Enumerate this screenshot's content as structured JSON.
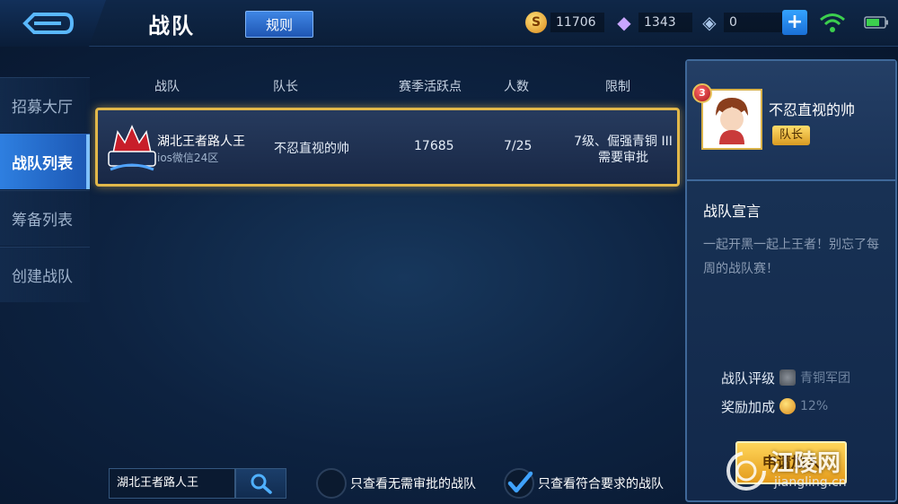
{
  "header": {
    "title": "战队",
    "rules_label": "规则",
    "currencies": [
      {
        "name": "gold-coin",
        "value": "11706"
      },
      {
        "name": "diamond",
        "value": "1343"
      },
      {
        "name": "voucher",
        "value": "0"
      }
    ]
  },
  "sidebar": {
    "items": [
      {
        "label": "招募大厅",
        "active": false
      },
      {
        "label": "战队列表",
        "active": true
      },
      {
        "label": "筹备列表",
        "active": false
      },
      {
        "label": "创建战队",
        "active": false
      }
    ]
  },
  "table": {
    "headers": [
      "战队",
      "队长",
      "赛季活跃点",
      "人数",
      "限制"
    ],
    "rows": [
      {
        "team_name": "湖北王者路人王",
        "server": "ios微信24区",
        "captain": "不忍直视的帅",
        "season_points": "17685",
        "members": "7/25",
        "limit_line1": "7级、倔强青铜 III",
        "limit_line2": "需要审批"
      }
    ]
  },
  "search": {
    "value": "湖北王者路人王"
  },
  "filters": [
    {
      "label": "只查看无需审批的战队",
      "checked": false
    },
    {
      "label": "只查看符合要求的战队",
      "checked": true
    }
  ],
  "detail": {
    "captain_level": "3",
    "captain_name": "不忍直视的帅",
    "captain_tag": "队长",
    "declaration_title": "战队宣言",
    "declaration_text": "一起开黑一起上王者！别忘了每周的战队赛！",
    "rating_label": "战队评级",
    "rating_value": "青铜军团",
    "bonus_label": "奖励加成",
    "bonus_value": "12%",
    "apply_label": "申请加入"
  },
  "watermark": {
    "main": "江陵网",
    "sub": "jiangling.cn"
  },
  "colors": {
    "accent_blue": "#2e7fe0",
    "highlight_gold": "#e2b84a",
    "background": "#0d2240"
  }
}
